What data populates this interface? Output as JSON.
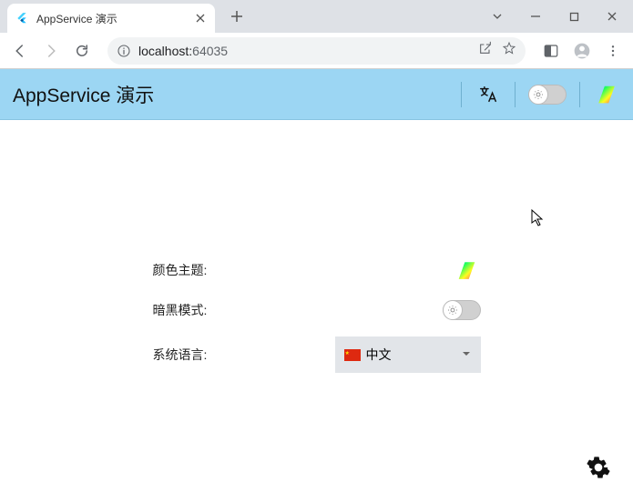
{
  "browser": {
    "tab_title": "AppService 演示",
    "url_host": "localhost:",
    "url_port": "64035"
  },
  "app": {
    "header_title": "AppService 演示"
  },
  "form": {
    "color_theme_label": "颜色主题:",
    "dark_mode_label": "暗黑模式:",
    "language_label": "系统语言:",
    "language_value": "中文"
  }
}
